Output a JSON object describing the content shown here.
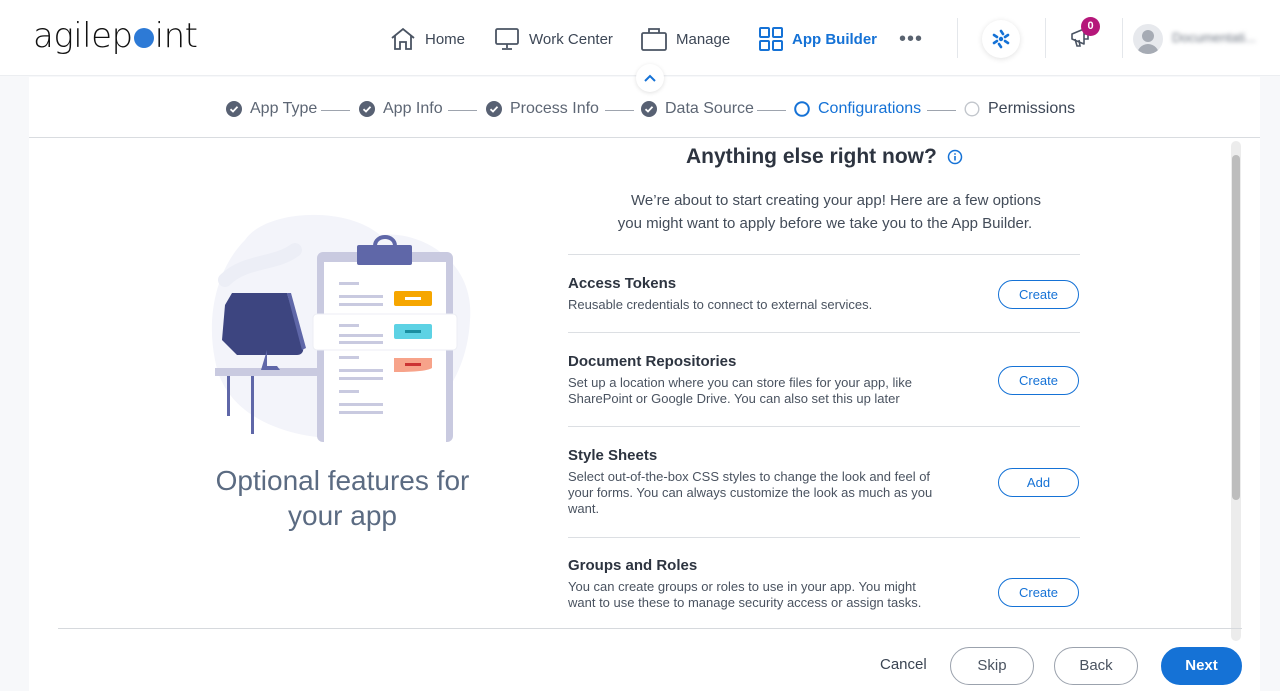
{
  "brand": {
    "logo_pre": "agilep",
    "logo_post": "int",
    "accent": "#1572d6",
    "logo_dot": "#2d7ad6"
  },
  "nav": {
    "items": [
      {
        "label": "Home",
        "icon": "home-icon",
        "active": false
      },
      {
        "label": "Work Center",
        "icon": "monitor-icon",
        "active": false
      },
      {
        "label": "Manage",
        "icon": "briefcase-icon",
        "active": false
      },
      {
        "label": "App Builder",
        "icon": "grid-icon",
        "active": true
      }
    ],
    "more": "•••",
    "notifications_count": "0",
    "user_name": "Documentati..."
  },
  "stepper": {
    "steps": [
      {
        "label": "App Type",
        "state": "done"
      },
      {
        "label": "App Info",
        "state": "done"
      },
      {
        "label": "Process Info",
        "state": "done"
      },
      {
        "label": "Data Source",
        "state": "done"
      },
      {
        "label": "Configurations",
        "state": "current"
      },
      {
        "label": "Permissions",
        "state": "pending"
      }
    ]
  },
  "left": {
    "title": "Optional features for your app"
  },
  "main": {
    "heading": "Anything else right now?",
    "intro_line1": "We’re about to start creating your app! Here are a few options",
    "intro_line2": "you might want to apply before we take you to the App Builder.",
    "options": [
      {
        "title": "Access Tokens",
        "description": "Reusable credentials to connect to external services.",
        "button": "Create"
      },
      {
        "title": "Document Repositories",
        "description": "Set up a location where you can store files for your app, like SharePoint or Google Drive. You can also set this up later",
        "button": "Create"
      },
      {
        "title": "Style Sheets",
        "description": "Select out-of-the-box CSS styles to change the look and feel of your forms. You can always customize the look as much as you want.",
        "button": "Add"
      },
      {
        "title": "Groups and Roles",
        "description": "You can create groups or roles to use in your app. You might want to use these to manage security access or assign tasks.",
        "button": "Create"
      }
    ]
  },
  "footer": {
    "cancel": "Cancel",
    "skip": "Skip",
    "back": "Back",
    "next": "Next"
  }
}
